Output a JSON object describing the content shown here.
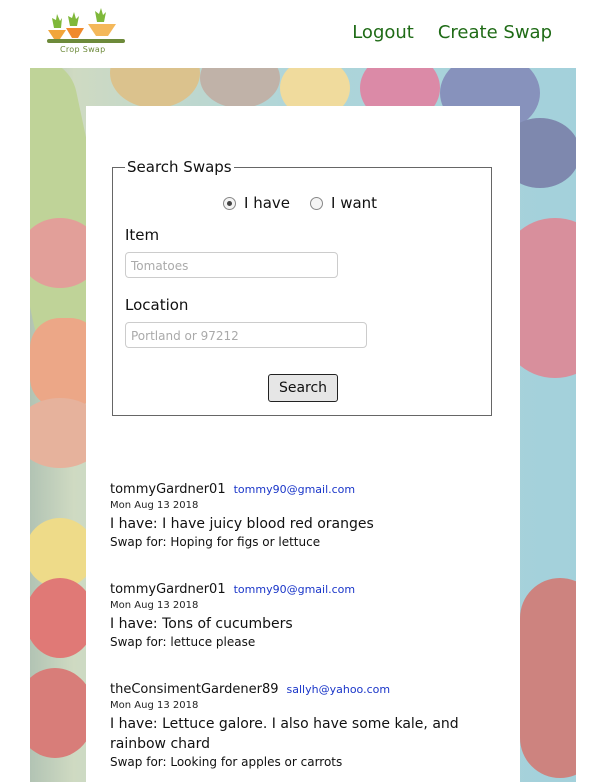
{
  "header": {
    "logo_text": "Crop Swap",
    "nav": {
      "logout": "Logout",
      "create_swap": "Create Swap"
    }
  },
  "search": {
    "legend": "Search Swaps",
    "radios": [
      {
        "label": "I have",
        "checked": true
      },
      {
        "label": "I want",
        "checked": false
      }
    ],
    "item_label": "Item",
    "item_placeholder": "Tomatoes",
    "location_label": "Location",
    "location_placeholder": "Portland or 97212",
    "button_label": "Search"
  },
  "listings": [
    {
      "user": "tommyGardner01",
      "email": "tommy90@gmail.com",
      "date": "Mon Aug 13 2018",
      "have": "I have: I have juicy blood red oranges",
      "want": "Swap for: Hoping for figs or lettuce"
    },
    {
      "user": "tommyGardner01",
      "email": "tommy90@gmail.com",
      "date": "Mon Aug 13 2018",
      "have": "I have: Tons of cucumbers",
      "want": "Swap for: lettuce please"
    },
    {
      "user": "theConsimentGardener89",
      "email": "sallyh@yahoo.com",
      "date": "Mon Aug 13 2018",
      "have": "I have: Lettuce galore. I also have some kale, and rainbow chard",
      "want": "Swap for: Looking for apples or carrots"
    }
  ]
}
